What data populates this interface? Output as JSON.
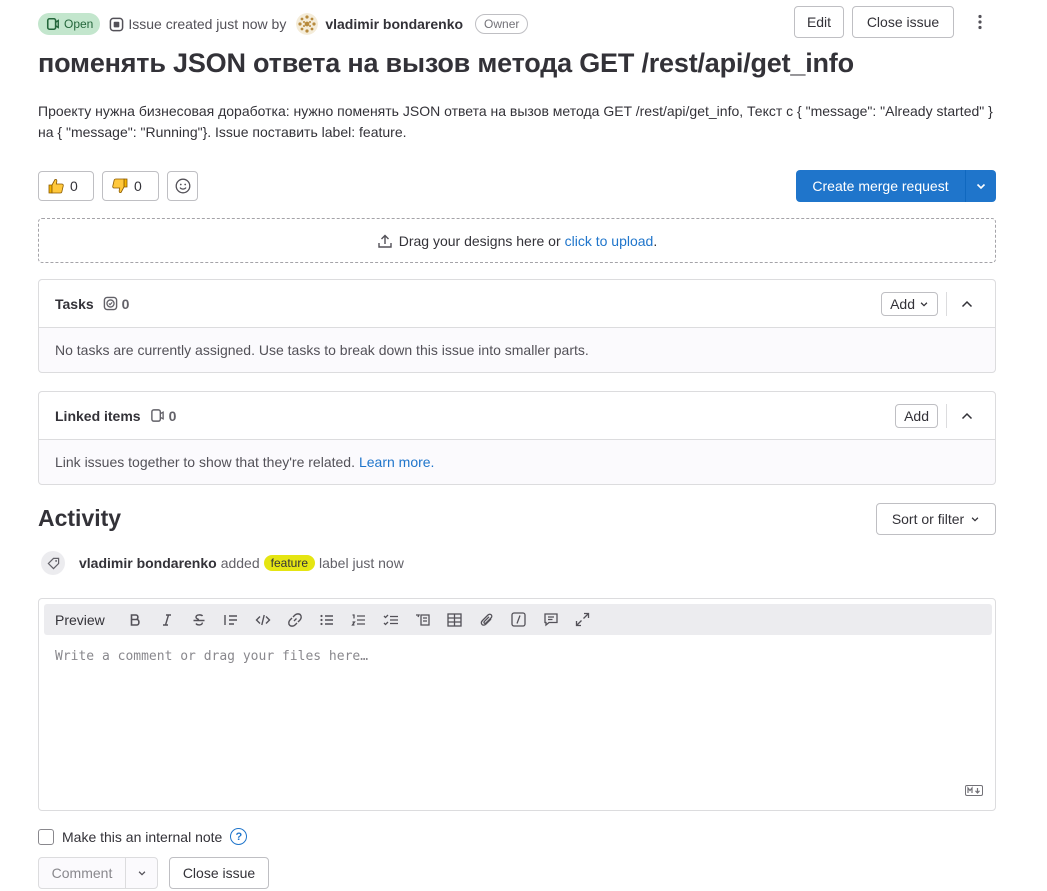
{
  "header": {
    "status_label": "Open",
    "created_text": "Issue created just now by",
    "author": "vladimir bondarenko",
    "role_badge": "Owner",
    "edit_label": "Edit",
    "close_label": "Close issue"
  },
  "issue": {
    "title": "поменять JSON ответа на вызов метода GET /rest/api/get_info",
    "description": "Проекту нужна бизнесовая доработка: нужно поменять JSON ответа на вызов метода GET /rest/api/get_info, Текст с { \"message\": \"Already started\" } на { \"message\": \"Running\"}. Issue поставить label: feature."
  },
  "reactions": {
    "thumbs_up": "0",
    "thumbs_down": "0"
  },
  "merge_request": {
    "label": "Create merge request"
  },
  "dropzone": {
    "text": "Drag your designs here or",
    "link": "click to upload",
    "suffix": "."
  },
  "tasks": {
    "title": "Tasks",
    "count": "0",
    "add_label": "Add",
    "empty_text": "No tasks are currently assigned. Use tasks to break down this issue into smaller parts."
  },
  "linked": {
    "title": "Linked items",
    "count": "0",
    "add_label": "Add",
    "empty_text": "Link issues together to show that they're related.",
    "learn_more": "Learn more."
  },
  "activity": {
    "title": "Activity",
    "sort_label": "Sort or filter",
    "event": {
      "author": "vladimir bondarenko",
      "action": "added",
      "label": "feature",
      "suffix": "label just now"
    }
  },
  "editor": {
    "preview_label": "Preview",
    "placeholder": "Write a comment or drag your files here…",
    "toolbar_icons": [
      "bold-icon",
      "italic-icon",
      "strikethrough-icon",
      "quote-icon",
      "code-icon",
      "link-icon",
      "bulleted-list-icon",
      "numbered-list-icon",
      "task-list-icon",
      "collapsible-icon",
      "table-icon",
      "attachment-icon",
      "quick-action-icon",
      "comment-icon",
      "fullscreen-icon"
    ]
  },
  "footer": {
    "internal_note_label": "Make this an internal note",
    "comment_label": "Comment",
    "close_label": "Close issue"
  },
  "colors": {
    "primary": "#1f75cb",
    "open_badge_bg": "#c3e6cd",
    "open_badge_fg": "#24663b",
    "label_feature": "#e5e512"
  }
}
